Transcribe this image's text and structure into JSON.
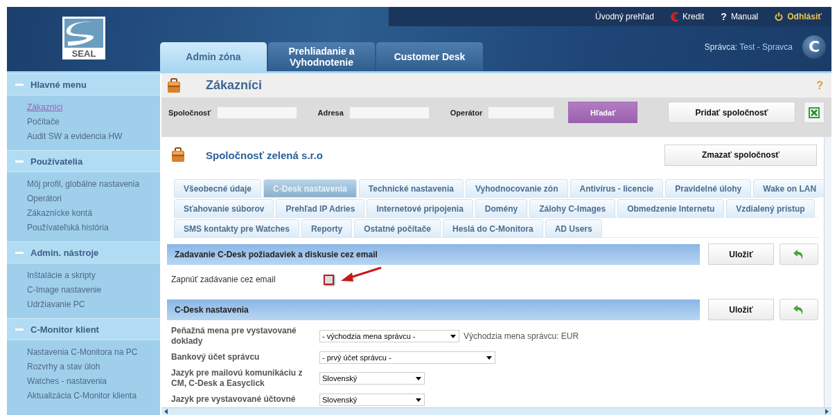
{
  "header": {
    "logo_text": "SEAL",
    "brand_glyph": "C",
    "user_label": "Správca:",
    "user_name": "Test - Spravca",
    "top_links": [
      {
        "label": "Úvodný prehľad",
        "kind": "plain"
      },
      {
        "label": "Kredit",
        "kind": "credit"
      },
      {
        "label": "Manual",
        "kind": "help",
        "glyph": "?"
      },
      {
        "label": "Odhlásiť",
        "kind": "logout"
      }
    ],
    "main_tabs": [
      {
        "label": "Admin zóna",
        "selected": true
      },
      {
        "label": "Prehliadanie a Vyhodnotenie",
        "selected": false
      },
      {
        "label": "Customer Desk",
        "selected": false
      }
    ]
  },
  "sidebar": {
    "sections": [
      {
        "title": "Hlavné menu",
        "expanded": true,
        "items": [
          {
            "label": "Zákazníci",
            "selected": true
          },
          {
            "label": "Počítače",
            "selected": false
          },
          {
            "label": "Audit SW a evidencia HW",
            "selected": false
          }
        ]
      },
      {
        "title": "Používatelia",
        "expanded": true,
        "items": [
          {
            "label": "Môj profil, globálne nastavenia",
            "selected": false
          },
          {
            "label": "Operátori",
            "selected": false
          },
          {
            "label": "Zákaznícke kontá",
            "selected": false
          },
          {
            "label": "Používateľská história",
            "selected": false
          }
        ]
      },
      {
        "title": "Admin. nástroje",
        "expanded": true,
        "items": [
          {
            "label": "Inštalácie a skripty",
            "selected": false
          },
          {
            "label": "C-Image nastavenie",
            "selected": false
          },
          {
            "label": "Udržiavanie PC",
            "selected": false
          }
        ]
      },
      {
        "title": "C-Monitor klient",
        "expanded": true,
        "items": [
          {
            "label": "Nastavenia C-Monitora na PC",
            "selected": false
          },
          {
            "label": "Rozvrhy a stav úloh",
            "selected": false
          },
          {
            "label": "Watches - nastavenia",
            "selected": false
          },
          {
            "label": "Aktualizácia C-Monitor klienta",
            "selected": false
          }
        ]
      }
    ]
  },
  "page": {
    "title": "Zákazníci",
    "help_glyph": "?",
    "search_button": "Hľadať",
    "add_button": "Pridať spoločnosť",
    "filters": [
      {
        "label": "Spoločnosť"
      },
      {
        "label": "Adresa"
      },
      {
        "label": "Operátor"
      }
    ]
  },
  "company": {
    "name": "Spoločnosť zelená s.r.o",
    "delete_button": "Zmazať spoločnosť",
    "tab_rows": [
      {
        "tabs": [
          {
            "label": "Všeobecné údaje",
            "selected": false
          },
          {
            "label": "C-Desk nastavenia",
            "selected": true
          },
          {
            "label": "Technické nastavenia",
            "selected": false
          },
          {
            "label": "Vyhodnocovanie zón",
            "selected": false
          },
          {
            "label": "Antivírus - licencie",
            "selected": false
          },
          {
            "label": "Pravidelné úlohy",
            "selected": false
          },
          {
            "label": "Wake on LAN",
            "selected": false
          }
        ]
      },
      {
        "tabs": [
          {
            "label": "Sťahovanie súborov",
            "selected": false
          },
          {
            "label": "Prehľad IP Adries",
            "selected": false
          },
          {
            "label": "Internetové pripojenia",
            "selected": false
          },
          {
            "label": "Domény",
            "selected": false
          },
          {
            "label": "Zálohy C-Images",
            "selected": false
          },
          {
            "label": "Obmedzenie Internetu",
            "selected": false
          },
          {
            "label": "Vzdialený prístup",
            "selected": false
          }
        ]
      },
      {
        "tabs": [
          {
            "label": "SMS kontakty pre Watches",
            "selected": false
          },
          {
            "label": "Reporty",
            "selected": false
          },
          {
            "label": "Ostatné počítače",
            "selected": false
          },
          {
            "label": "Heslá do C-Monitora",
            "selected": false
          },
          {
            "label": "AD Users",
            "selected": false
          }
        ]
      }
    ]
  },
  "sections": [
    {
      "title": "Zadavanie C-Desk požiadaviek a diskusie cez email",
      "save_button": "Uložiť",
      "fields": [
        {
          "kind": "checkbox",
          "label": "Zapnúť zadávanie cez email",
          "checked": false
        }
      ]
    },
    {
      "title": "C-Desk nastavenia",
      "save_button": "Uložiť",
      "fields": [
        {
          "kind": "select",
          "label": "Peňažná mena pre vystavované doklady",
          "value": "- východzia mena správcu -",
          "note": "Východzia mena správcu: EUR"
        },
        {
          "kind": "select",
          "label": "Bankový účet správcu",
          "value": "- prvý účet správcu -"
        },
        {
          "kind": "select",
          "label": "Jazyk pre mailovú komunikáciu z CM, C-Desk a Easyclick",
          "value": "Slovenský"
        },
        {
          "kind": "select",
          "label": "Jazyk pre vystavované účtovné",
          "value": "Slovenský"
        }
      ]
    }
  ]
}
